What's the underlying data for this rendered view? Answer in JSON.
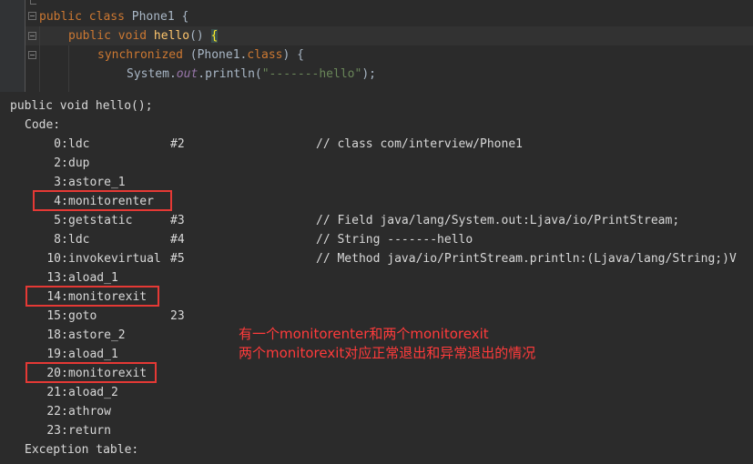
{
  "editor": {
    "line1": {
      "kw": "public class",
      "name": "Phone1",
      "tail": " {"
    },
    "line2": {
      "kw": "public void",
      "name": "hello",
      "tail": "() ",
      "brace": "{"
    },
    "line3": {
      "kw": "synchronized",
      "pre": " (Phone1.",
      "kw2": "class",
      "post": ") {"
    },
    "line4": {
      "pre": "System.",
      "field": "out",
      "mid": ".println(",
      "str": "\"-------hello\"",
      "post": ");"
    }
  },
  "bytecode": {
    "header": "public void hello();",
    "code_label": "Code:",
    "instructions": [
      {
        "offset": "0",
        "op": "ldc",
        "arg": "#2",
        "comment": "// class com/interview/Phone1"
      },
      {
        "offset": "2",
        "op": "dup",
        "arg": "",
        "comment": ""
      },
      {
        "offset": "3",
        "op": "astore_1",
        "arg": "",
        "comment": ""
      },
      {
        "offset": "4",
        "op": "monitorenter",
        "arg": "",
        "comment": ""
      },
      {
        "offset": "5",
        "op": "getstatic",
        "arg": "#3",
        "comment": "// Field java/lang/System.out:Ljava/io/PrintStream;"
      },
      {
        "offset": "8",
        "op": "ldc",
        "arg": "#4",
        "comment": "// String -------hello"
      },
      {
        "offset": "10",
        "op": "invokevirtual",
        "arg": "#5",
        "comment": "// Method java/io/PrintStream.println:(Ljava/lang/String;)V"
      },
      {
        "offset": "13",
        "op": "aload_1",
        "arg": "",
        "comment": ""
      },
      {
        "offset": "14",
        "op": "monitorexit",
        "arg": "",
        "comment": ""
      },
      {
        "offset": "15",
        "op": "goto",
        "arg": "23",
        "comment": ""
      },
      {
        "offset": "18",
        "op": "astore_2",
        "arg": "",
        "comment": ""
      },
      {
        "offset": "19",
        "op": "aload_1",
        "arg": "",
        "comment": ""
      },
      {
        "offset": "20",
        "op": "monitorexit",
        "arg": "",
        "comment": ""
      },
      {
        "offset": "21",
        "op": "aload_2",
        "arg": "",
        "comment": ""
      },
      {
        "offset": "22",
        "op": "athrow",
        "arg": "",
        "comment": ""
      },
      {
        "offset": "23",
        "op": "return",
        "arg": "",
        "comment": ""
      }
    ],
    "exception_label": "Exception table:"
  },
  "annotation": {
    "line1": "有一个monitorenter和两个monitorexit",
    "line2": "两个monitorexit对应正常退出和异常退出的情况"
  },
  "colors": {
    "highlight_box": "#e53935",
    "annotation_text": "#ff3b3b"
  }
}
